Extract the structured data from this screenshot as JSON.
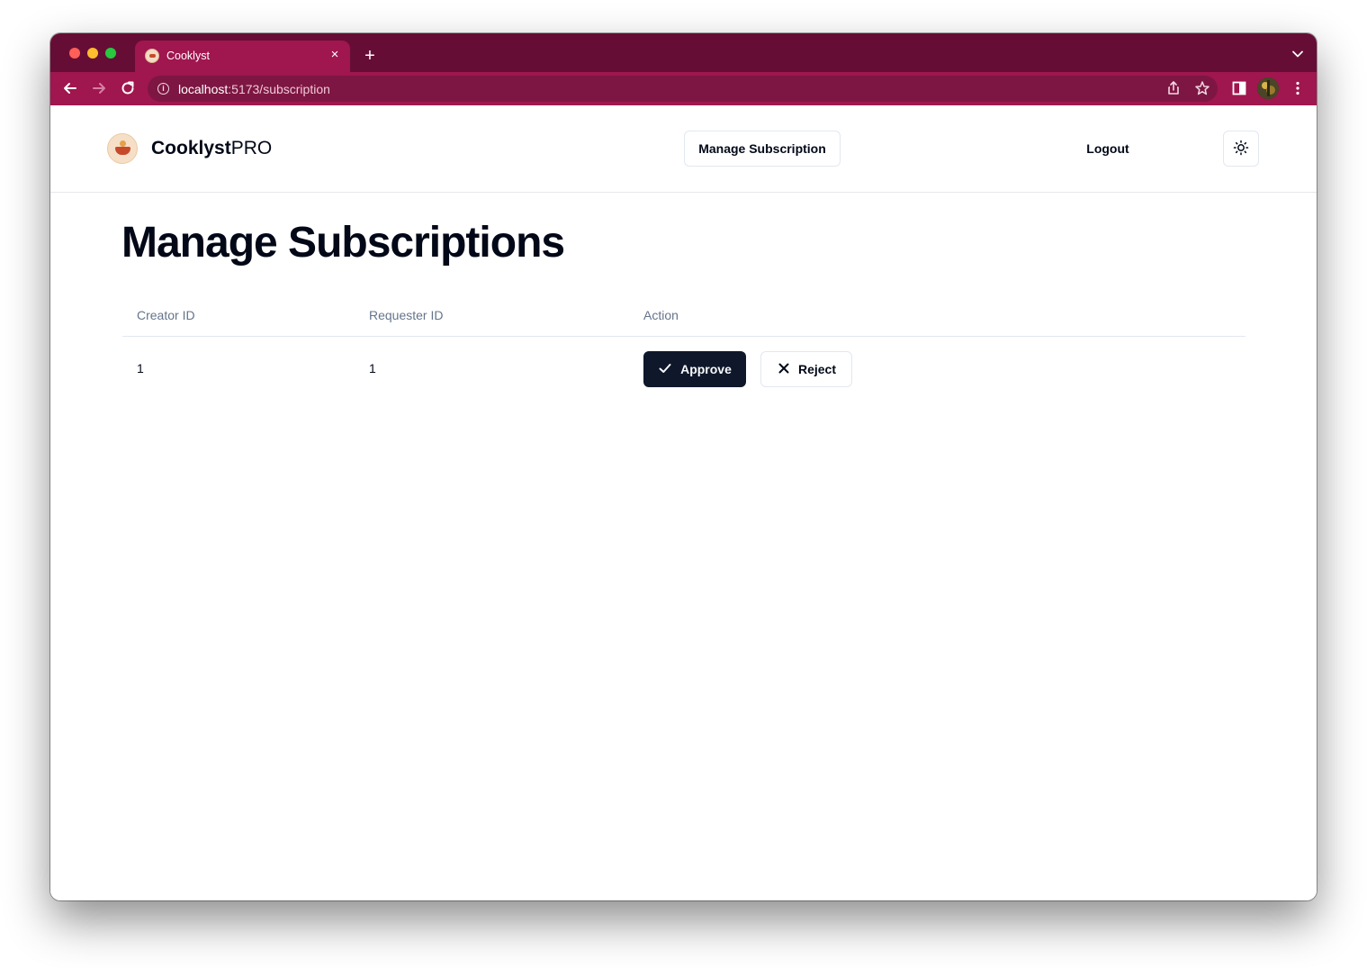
{
  "browser": {
    "tab_title": "Cooklyst",
    "url_host": "localhost",
    "url_path": ":5173/subscription",
    "tab_close_glyph": "×",
    "new_tab_glyph": "+",
    "icons": {
      "info": "i"
    }
  },
  "navbar": {
    "brand_strong": "Cooklyst",
    "brand_light": "PRO",
    "manage_label": "Manage Subscription",
    "logout_label": "Logout"
  },
  "page": {
    "heading": "Manage Subscriptions"
  },
  "table": {
    "headers": [
      "Creator ID",
      "Requester ID",
      "Action"
    ],
    "rows": [
      {
        "creator_id": "1",
        "requester_id": "1",
        "approve_label": "Approve",
        "reject_label": "Reject"
      }
    ]
  },
  "colors": {
    "tabstrip": "#660d35",
    "toolbar": "#a0164f",
    "primary_button": "#0f172a"
  }
}
